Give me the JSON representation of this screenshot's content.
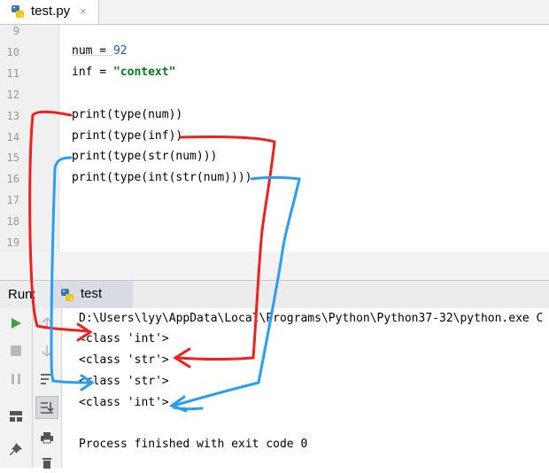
{
  "editor_tab": {
    "label": "test.py",
    "close": "×"
  },
  "editor": {
    "lines": [
      {
        "num": "9",
        "code": ""
      },
      {
        "num": "10",
        "code_parts": [
          "num = ",
          "92"
        ]
      },
      {
        "num": "11",
        "code_parts": [
          "inf = ",
          "\"context\""
        ]
      },
      {
        "num": "12",
        "code": ""
      },
      {
        "num": "13",
        "code": "print(type(num))"
      },
      {
        "num": "14",
        "code": "print(type(inf))"
      },
      {
        "num": "15",
        "code": "print(type(str(num)))"
      },
      {
        "num": "16",
        "code": "print(type(int(str(num))))"
      },
      {
        "num": "17",
        "code": ""
      },
      {
        "num": "18",
        "code": ""
      },
      {
        "num": "19",
        "code": ""
      }
    ]
  },
  "run_panel": {
    "label": "Run:",
    "tab_label": "test",
    "console": [
      "D:\\Users\\lyy\\AppData\\Local\\Programs\\Python\\Python37-32\\python.exe C",
      "<class 'int'>",
      "<class 'str'>",
      "<class 'str'>",
      "<class 'int'>",
      "",
      "Process finished with exit code 0"
    ]
  },
  "icons": {
    "tab_file": "python-file-icon",
    "run_tab": "python-file-icon",
    "rerun": "play-icon",
    "stop": "stop-icon",
    "pause": "pause-icon",
    "layout": "layout-icon",
    "pin": "pin-icon",
    "up": "arrow-up-icon",
    "down": "arrow-down-icon",
    "wrap": "soft-wrap-icon",
    "scroll_end": "scroll-to-end-icon",
    "print": "print-icon",
    "trash": "trash-icon"
  },
  "colors": {
    "annotation_red": "#ee2020",
    "annotation_blue": "#2a9df4",
    "run_green": "#3fa33f"
  }
}
